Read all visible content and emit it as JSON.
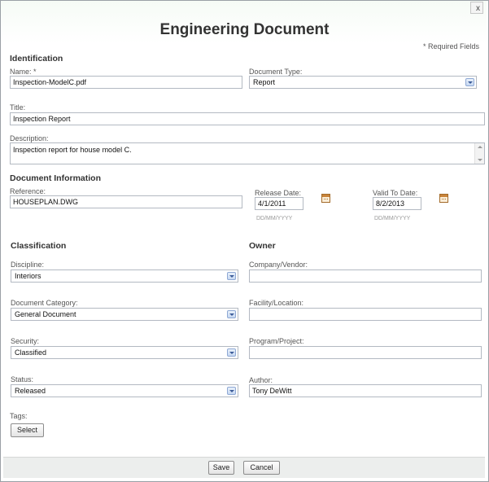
{
  "dialog": {
    "close_label": "x",
    "title": "Engineering Document",
    "required_note": "* Required Fields"
  },
  "identification": {
    "heading": "Identification",
    "name_label": "Name: *",
    "name_value": "Inspection-ModelC.pdf",
    "doctype_label": "Document Type:",
    "doctype_value": "Report",
    "title_label": "Title:",
    "title_value": "Inspection Report",
    "description_label": "Description:",
    "description_value": "Inspection report for house model C."
  },
  "document_information": {
    "heading": "Document Information",
    "reference_label": "Reference:",
    "reference_value": "HOUSEPLAN.DWG",
    "release_label": "Release Date:",
    "release_value": "4/1/2011",
    "release_hint": "DD/MM/YYYY",
    "valid_label": "Valid To Date:",
    "valid_value": "8/2/2013",
    "valid_hint": "DD/MM/YYYY"
  },
  "classification": {
    "heading": "Classification",
    "discipline_label": "Discipline:",
    "discipline_value": "Interiors",
    "category_label": "Document Category:",
    "category_value": "General Document",
    "security_label": "Security:",
    "security_value": "Classified",
    "status_label": "Status:",
    "status_value": "Released"
  },
  "owner": {
    "heading": "Owner",
    "company_label": "Company/Vendor:",
    "company_value": "",
    "facility_label": "Facility/Location:",
    "facility_value": "",
    "program_label": "Program/Project:",
    "program_value": "",
    "author_label": "Author:",
    "author_value": "Tony DeWitt"
  },
  "tags": {
    "label": "Tags:",
    "select_button": "Select"
  },
  "footer": {
    "save": "Save",
    "cancel": "Cancel"
  },
  "icons": {
    "close": "close-icon",
    "calendar": "calendar-icon",
    "dropdown": "chevron-down-icon"
  }
}
